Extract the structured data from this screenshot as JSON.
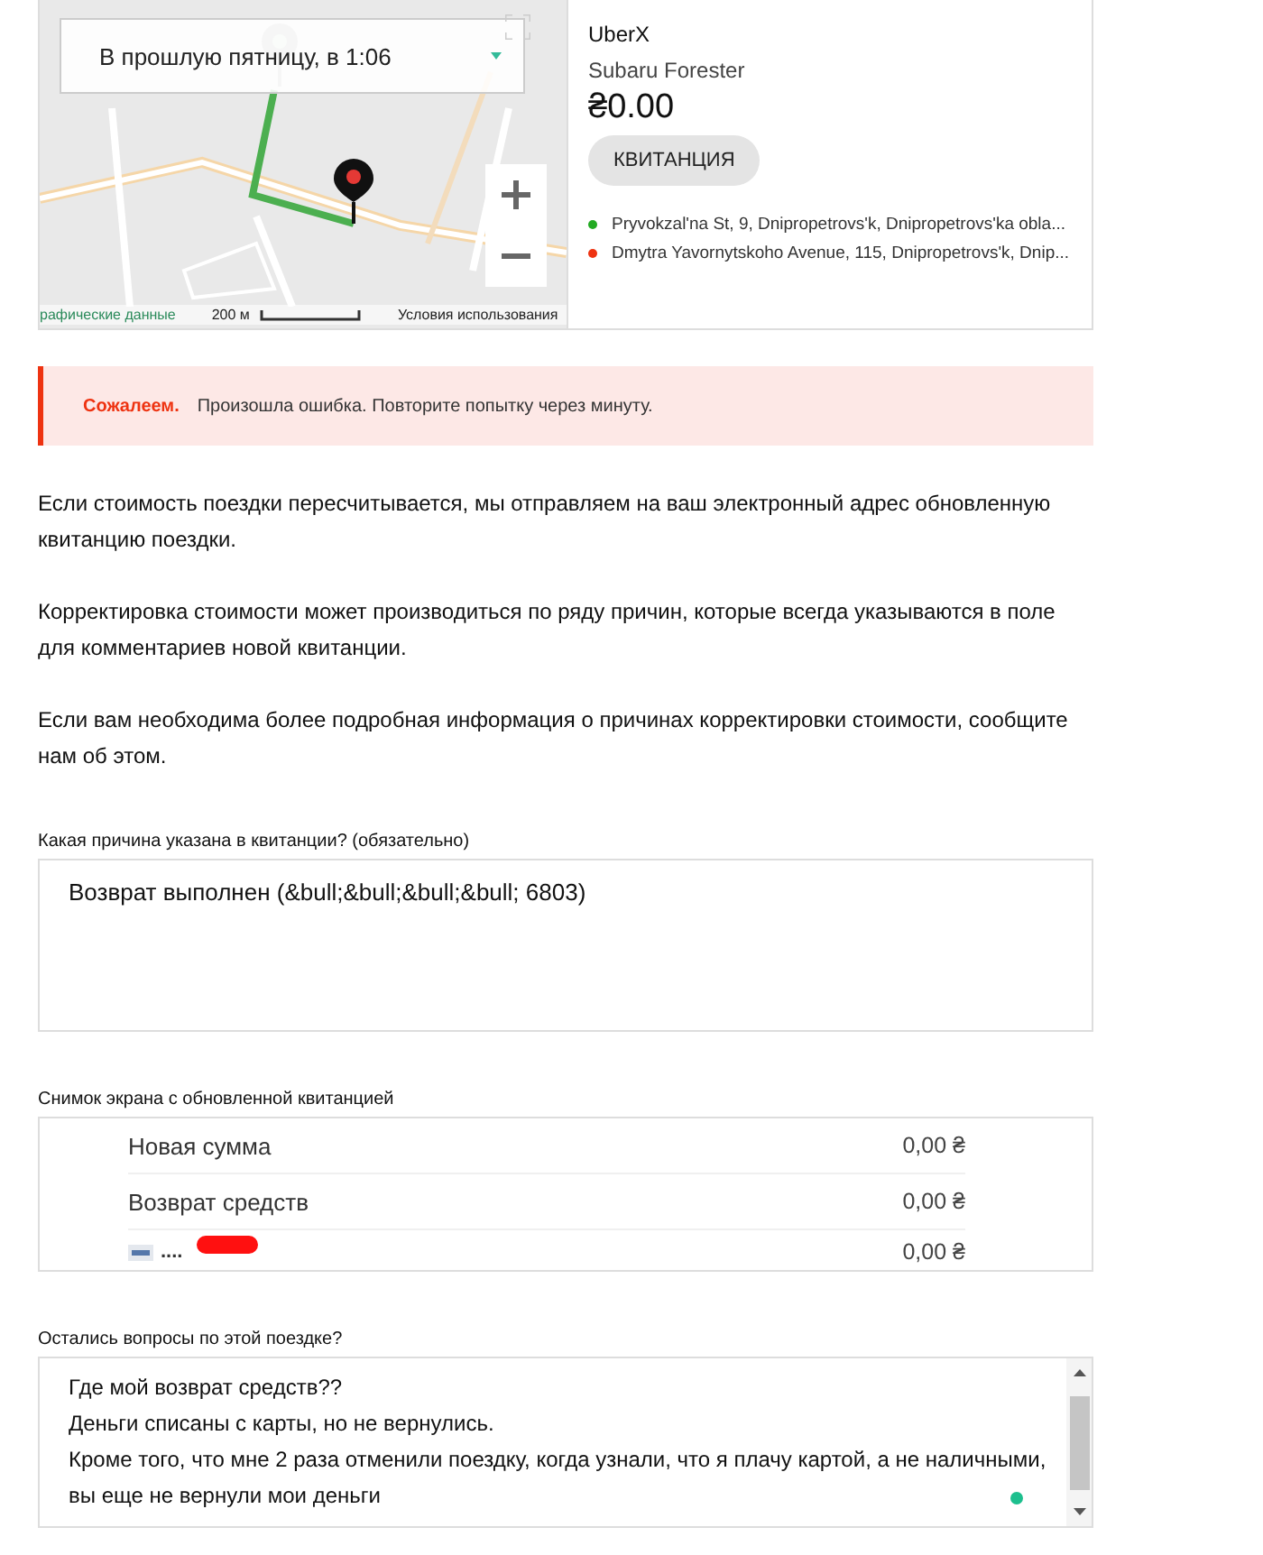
{
  "trip": {
    "map": {
      "time_select": "В прошлую пятницу, в 1:06",
      "attribution": "рафические данные",
      "scale": "200 м",
      "terms": "Условия использования"
    },
    "product": "UberX",
    "vehicle": "Subaru Forester",
    "fare": "₴0.00",
    "receipt_button": "КВИТАНЦИЯ",
    "stops": [
      {
        "address": "Pryvokzal'na St, 9, Dnipropetrovs'k, Dnipropetrovs'ka obla...",
        "color": "#22aa22"
      },
      {
        "address": "Dmytra Yavornytskoho Avenue, 115, Dnipropetrovs'k, Dnip...",
        "color": "#ee3311"
      }
    ]
  },
  "error": {
    "title": "Сожалеем.",
    "message": "Произошла ошибка. Повторите попытку через минуту."
  },
  "paragraphs": [
    "Если стоимость поездки пересчитывается, мы отправляем на ваш электронный адрес обновленную квитанцию поездки.",
    "Корректировка стоимости может производиться по ряду причин, которые всегда указываются в поле для комментариев новой квитанции.",
    "Если вам необходима более подробная информация о причинах корректировки стоимости, сообщите нам об этом."
  ],
  "reason": {
    "label": "Какая причина указана в квитанции? (обязательно)",
    "value": "Возврат выполнен (&bull;&bull;&bull;&bull; 6803)"
  },
  "screenshot": {
    "label": "Снимок экрана с обновленной квитанцией",
    "rows": [
      {
        "kind": "text",
        "label": "Новая сумма",
        "amount": "0,00 ₴"
      },
      {
        "kind": "text",
        "label": "Возврат средств",
        "amount": "0,00 ₴"
      },
      {
        "kind": "card",
        "label": "....",
        "amount": "0,00 ₴"
      }
    ]
  },
  "questions": {
    "label": "Остались вопросы по этой поездке?",
    "lines": [
      "Где мой возврат средств??",
      "Деньги списаны с карты, но не вернулись.",
      "Кроме того, что мне 2 раза отменили поездку, когда узнали, что я плачу картой, а не наличными,",
      "вы еще не вернули мои деньги"
    ]
  }
}
